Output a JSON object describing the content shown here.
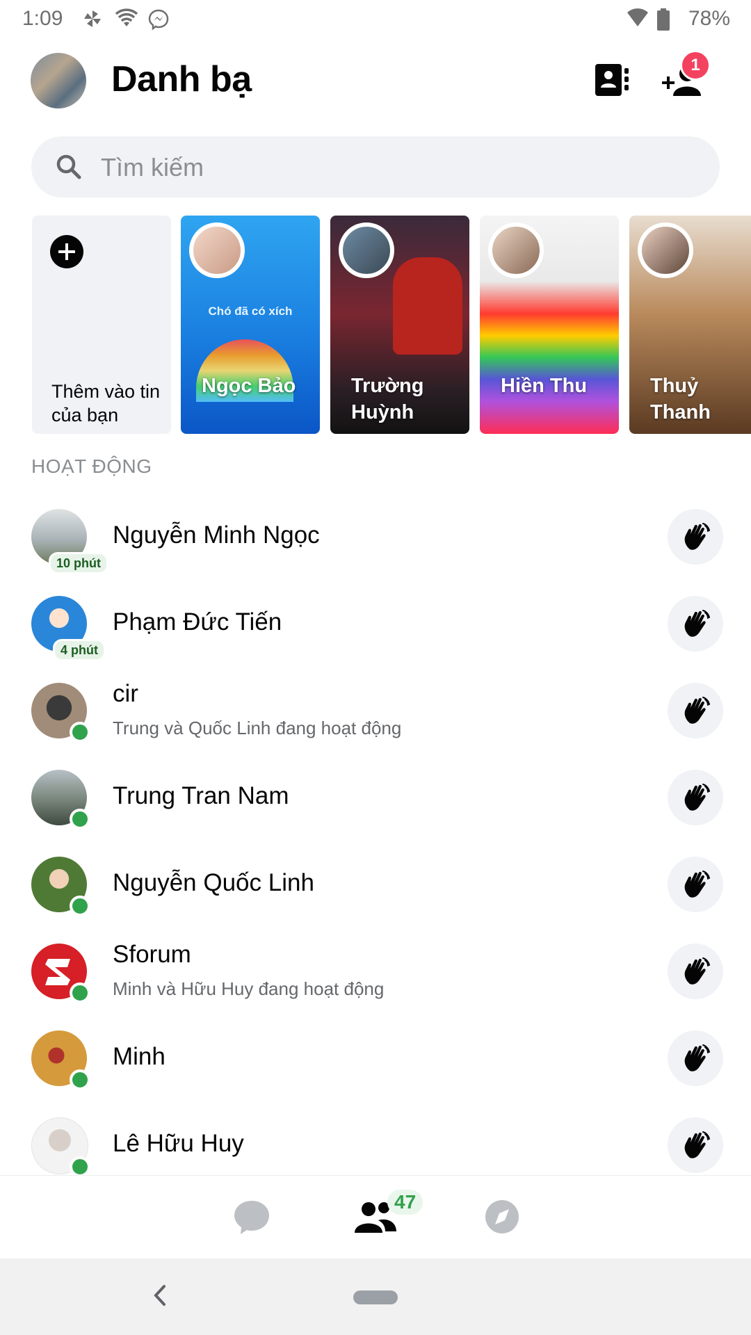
{
  "status_bar": {
    "time": "1:09",
    "battery": "78%",
    "icons": [
      "pinwheel-icon",
      "wifi-icon",
      "messenger-icon",
      "signal-icon",
      "battery-icon"
    ]
  },
  "header": {
    "title": "Danh bạ",
    "add_friend_badge": "1"
  },
  "search": {
    "placeholder": "Tìm kiếm"
  },
  "stories": {
    "add_label": "Thêm vào tin của bạn",
    "items": [
      {
        "name": "Ngọc Bảo",
        "caption": "Chó đã có xích"
      },
      {
        "name": "Trường Huỳnh"
      },
      {
        "name": "Hiền Thu"
      },
      {
        "name": "Thuỷ Thanh"
      }
    ]
  },
  "section_title": "HOẠT ĐỘNG",
  "contacts": [
    {
      "name": "Nguyễn Minh Ngọc",
      "last_active": "10 phút"
    },
    {
      "name": "Phạm Đức Tiến",
      "last_active": "4 phút"
    },
    {
      "name": "cir",
      "subtitle": "Trung và Quốc Linh đang hoạt động",
      "online": true
    },
    {
      "name": "Trung Tran Nam",
      "online": true
    },
    {
      "name": "Nguyễn Quốc Linh",
      "online": true
    },
    {
      "name": "Sforum",
      "subtitle": "Minh và Hữu Huy đang hoạt động",
      "online": true
    },
    {
      "name": "Minh",
      "online": true
    },
    {
      "name": "Lê Hữu Huy",
      "online": true
    }
  ],
  "bottom_nav": {
    "items": [
      "chats-icon",
      "people-icon",
      "discover-icon"
    ],
    "people_badge": "47"
  },
  "colors": {
    "online": "#31a24c",
    "badge_red": "#f3425f",
    "search_bg": "#f0f2f5"
  }
}
